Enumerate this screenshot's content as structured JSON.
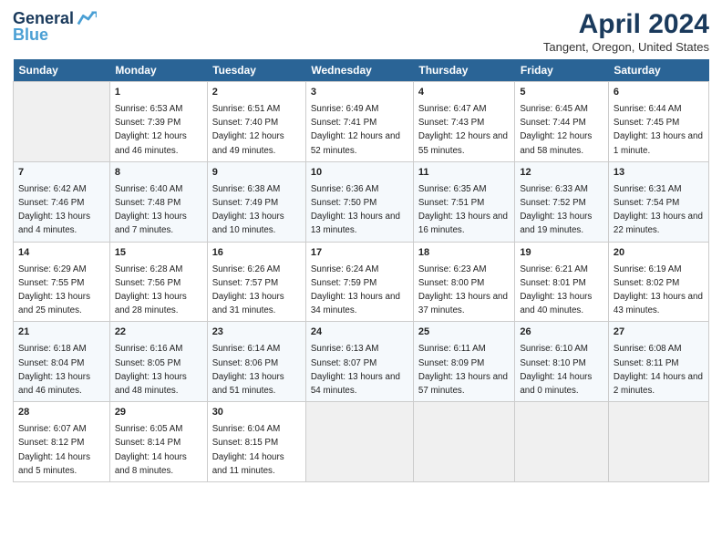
{
  "header": {
    "logo_line1": "General",
    "logo_line2": "Blue",
    "title": "April 2024",
    "subtitle": "Tangent, Oregon, United States"
  },
  "weekdays": [
    "Sunday",
    "Monday",
    "Tuesday",
    "Wednesday",
    "Thursday",
    "Friday",
    "Saturday"
  ],
  "weeks": [
    [
      {
        "day": "",
        "sunrise": "",
        "sunset": "",
        "daylight": "",
        "empty": true
      },
      {
        "day": "1",
        "sunrise": "Sunrise: 6:53 AM",
        "sunset": "Sunset: 7:39 PM",
        "daylight": "Daylight: 12 hours and 46 minutes."
      },
      {
        "day": "2",
        "sunrise": "Sunrise: 6:51 AM",
        "sunset": "Sunset: 7:40 PM",
        "daylight": "Daylight: 12 hours and 49 minutes."
      },
      {
        "day": "3",
        "sunrise": "Sunrise: 6:49 AM",
        "sunset": "Sunset: 7:41 PM",
        "daylight": "Daylight: 12 hours and 52 minutes."
      },
      {
        "day": "4",
        "sunrise": "Sunrise: 6:47 AM",
        "sunset": "Sunset: 7:43 PM",
        "daylight": "Daylight: 12 hours and 55 minutes."
      },
      {
        "day": "5",
        "sunrise": "Sunrise: 6:45 AM",
        "sunset": "Sunset: 7:44 PM",
        "daylight": "Daylight: 12 hours and 58 minutes."
      },
      {
        "day": "6",
        "sunrise": "Sunrise: 6:44 AM",
        "sunset": "Sunset: 7:45 PM",
        "daylight": "Daylight: 13 hours and 1 minute."
      }
    ],
    [
      {
        "day": "7",
        "sunrise": "Sunrise: 6:42 AM",
        "sunset": "Sunset: 7:46 PM",
        "daylight": "Daylight: 13 hours and 4 minutes."
      },
      {
        "day": "8",
        "sunrise": "Sunrise: 6:40 AM",
        "sunset": "Sunset: 7:48 PM",
        "daylight": "Daylight: 13 hours and 7 minutes."
      },
      {
        "day": "9",
        "sunrise": "Sunrise: 6:38 AM",
        "sunset": "Sunset: 7:49 PM",
        "daylight": "Daylight: 13 hours and 10 minutes."
      },
      {
        "day": "10",
        "sunrise": "Sunrise: 6:36 AM",
        "sunset": "Sunset: 7:50 PM",
        "daylight": "Daylight: 13 hours and 13 minutes."
      },
      {
        "day": "11",
        "sunrise": "Sunrise: 6:35 AM",
        "sunset": "Sunset: 7:51 PM",
        "daylight": "Daylight: 13 hours and 16 minutes."
      },
      {
        "day": "12",
        "sunrise": "Sunrise: 6:33 AM",
        "sunset": "Sunset: 7:52 PM",
        "daylight": "Daylight: 13 hours and 19 minutes."
      },
      {
        "day": "13",
        "sunrise": "Sunrise: 6:31 AM",
        "sunset": "Sunset: 7:54 PM",
        "daylight": "Daylight: 13 hours and 22 minutes."
      }
    ],
    [
      {
        "day": "14",
        "sunrise": "Sunrise: 6:29 AM",
        "sunset": "Sunset: 7:55 PM",
        "daylight": "Daylight: 13 hours and 25 minutes."
      },
      {
        "day": "15",
        "sunrise": "Sunrise: 6:28 AM",
        "sunset": "Sunset: 7:56 PM",
        "daylight": "Daylight: 13 hours and 28 minutes."
      },
      {
        "day": "16",
        "sunrise": "Sunrise: 6:26 AM",
        "sunset": "Sunset: 7:57 PM",
        "daylight": "Daylight: 13 hours and 31 minutes."
      },
      {
        "day": "17",
        "sunrise": "Sunrise: 6:24 AM",
        "sunset": "Sunset: 7:59 PM",
        "daylight": "Daylight: 13 hours and 34 minutes."
      },
      {
        "day": "18",
        "sunrise": "Sunrise: 6:23 AM",
        "sunset": "Sunset: 8:00 PM",
        "daylight": "Daylight: 13 hours and 37 minutes."
      },
      {
        "day": "19",
        "sunrise": "Sunrise: 6:21 AM",
        "sunset": "Sunset: 8:01 PM",
        "daylight": "Daylight: 13 hours and 40 minutes."
      },
      {
        "day": "20",
        "sunrise": "Sunrise: 6:19 AM",
        "sunset": "Sunset: 8:02 PM",
        "daylight": "Daylight: 13 hours and 43 minutes."
      }
    ],
    [
      {
        "day": "21",
        "sunrise": "Sunrise: 6:18 AM",
        "sunset": "Sunset: 8:04 PM",
        "daylight": "Daylight: 13 hours and 46 minutes."
      },
      {
        "day": "22",
        "sunrise": "Sunrise: 6:16 AM",
        "sunset": "Sunset: 8:05 PM",
        "daylight": "Daylight: 13 hours and 48 minutes."
      },
      {
        "day": "23",
        "sunrise": "Sunrise: 6:14 AM",
        "sunset": "Sunset: 8:06 PM",
        "daylight": "Daylight: 13 hours and 51 minutes."
      },
      {
        "day": "24",
        "sunrise": "Sunrise: 6:13 AM",
        "sunset": "Sunset: 8:07 PM",
        "daylight": "Daylight: 13 hours and 54 minutes."
      },
      {
        "day": "25",
        "sunrise": "Sunrise: 6:11 AM",
        "sunset": "Sunset: 8:09 PM",
        "daylight": "Daylight: 13 hours and 57 minutes."
      },
      {
        "day": "26",
        "sunrise": "Sunrise: 6:10 AM",
        "sunset": "Sunset: 8:10 PM",
        "daylight": "Daylight: 14 hours and 0 minutes."
      },
      {
        "day": "27",
        "sunrise": "Sunrise: 6:08 AM",
        "sunset": "Sunset: 8:11 PM",
        "daylight": "Daylight: 14 hours and 2 minutes."
      }
    ],
    [
      {
        "day": "28",
        "sunrise": "Sunrise: 6:07 AM",
        "sunset": "Sunset: 8:12 PM",
        "daylight": "Daylight: 14 hours and 5 minutes."
      },
      {
        "day": "29",
        "sunrise": "Sunrise: 6:05 AM",
        "sunset": "Sunset: 8:14 PM",
        "daylight": "Daylight: 14 hours and 8 minutes."
      },
      {
        "day": "30",
        "sunrise": "Sunrise: 6:04 AM",
        "sunset": "Sunset: 8:15 PM",
        "daylight": "Daylight: 14 hours and 11 minutes."
      },
      {
        "day": "",
        "sunrise": "",
        "sunset": "",
        "daylight": "",
        "empty": true
      },
      {
        "day": "",
        "sunrise": "",
        "sunset": "",
        "daylight": "",
        "empty": true
      },
      {
        "day": "",
        "sunrise": "",
        "sunset": "",
        "daylight": "",
        "empty": true
      },
      {
        "day": "",
        "sunrise": "",
        "sunset": "",
        "daylight": "",
        "empty": true
      }
    ]
  ]
}
